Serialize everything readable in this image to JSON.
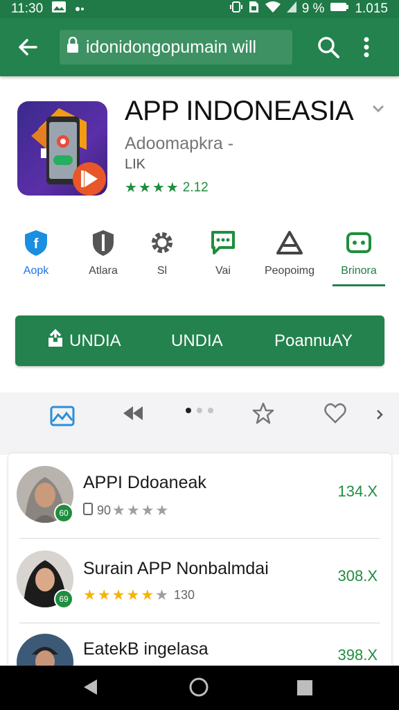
{
  "status_bar": {
    "time": "11:30",
    "battery": "9 %",
    "clock_right": "1.015"
  },
  "browser": {
    "url": "idonidongopumain will"
  },
  "app": {
    "title": "APP INDONEASIA",
    "developer": "Adoomapkra -",
    "subtitle": "LIK",
    "rating_text": "2.12",
    "stars_filled": 4
  },
  "tabs": [
    {
      "label": "Aopk",
      "icon": "shield-f-icon"
    },
    {
      "label": "Atlara",
      "icon": "shield-icon"
    },
    {
      "label": "Sl",
      "icon": "gear-icon"
    },
    {
      "label": "Vai",
      "icon": "chat-icon"
    },
    {
      "label": "Peopoimg",
      "icon": "triangle-logo-icon"
    },
    {
      "label": "Brinora",
      "icon": "game-icon"
    }
  ],
  "install_bar": {
    "label1": "UNDIA",
    "label2": "UNDIA",
    "label3": "PoannuAY"
  },
  "reviews": [
    {
      "name": "APPI Ddoaneak",
      "sub": "90",
      "count": "134.X",
      "badge": "60",
      "stars_filled": 0
    },
    {
      "name": "Surain APP Nonbalmdai",
      "sub": "130",
      "count": "308.X",
      "badge": "69",
      "stars_filled": 5
    },
    {
      "name": "EatekB ingelasa",
      "sub": "",
      "count": "398.X",
      "badge": "",
      "stars_filled": 0
    }
  ],
  "colors": {
    "primary": "#23824d",
    "status_bar": "#1f7a47",
    "accent_green": "#1e8e3e",
    "star_gold": "#f4b400"
  }
}
